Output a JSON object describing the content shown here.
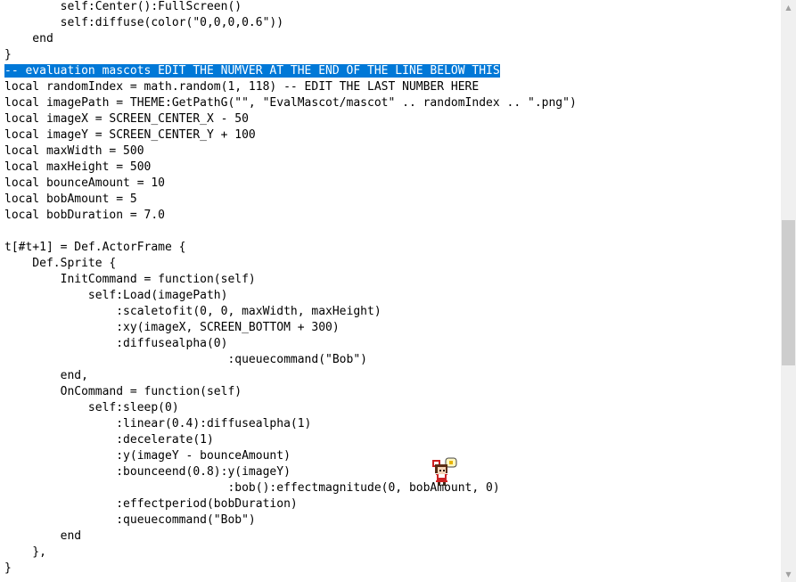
{
  "editor": {
    "selected_line_index": 4,
    "lines": [
      "        self:Center():FullScreen()",
      "        self:diffuse(color(\"0,0,0,0.6\"))",
      "    end",
      "}",
      "-- evaluation mascots EDIT THE NUMVER AT THE END OF THE LINE BELOW THIS",
      "local randomIndex = math.random(1, 118) -- EDIT THE LAST NUMBER HERE",
      "local imagePath = THEME:GetPathG(\"\", \"EvalMascot/mascot\" .. randomIndex .. \".png\")",
      "local imageX = SCREEN_CENTER_X - 50",
      "local imageY = SCREEN_CENTER_Y + 100",
      "local maxWidth = 500",
      "local maxHeight = 500",
      "local bounceAmount = 10",
      "local bobAmount = 5",
      "local bobDuration = 7.0",
      "",
      "t[#t+1] = Def.ActorFrame {",
      "    Def.Sprite {",
      "        InitCommand = function(self)",
      "            self:Load(imagePath)",
      "                :scaletofit(0, 0, maxWidth, maxHeight)",
      "                :xy(imageX, SCREEN_BOTTOM + 300)",
      "                :diffusealpha(0)",
      "                                :queuecommand(\"Bob\")",
      "        end,",
      "        OnCommand = function(self)",
      "            self:sleep(0)",
      "                :linear(0.4):diffusealpha(1)",
      "                :decelerate(1)",
      "                :y(imageY - bounceAmount)",
      "                :bounceend(0.8):y(imageY)",
      "                                :bob():effectmagnitude(0, bobAmount, 0)",
      "                :effectperiod(bobDuration)",
      "                :queuecommand(\"Bob\")",
      "        end",
      "    },",
      "}"
    ]
  },
  "mascot": {
    "icon": "mascot-sprite-icon"
  },
  "scrollbar": {
    "up_arrow": "▲",
    "down_arrow": "▼",
    "position": 0.62
  },
  "colors": {
    "selection_bg": "#0078d7",
    "selection_fg": "#ffffff",
    "scrollbar_track": "#f0f0f0",
    "scrollbar_thumb": "#cdcdcd"
  }
}
